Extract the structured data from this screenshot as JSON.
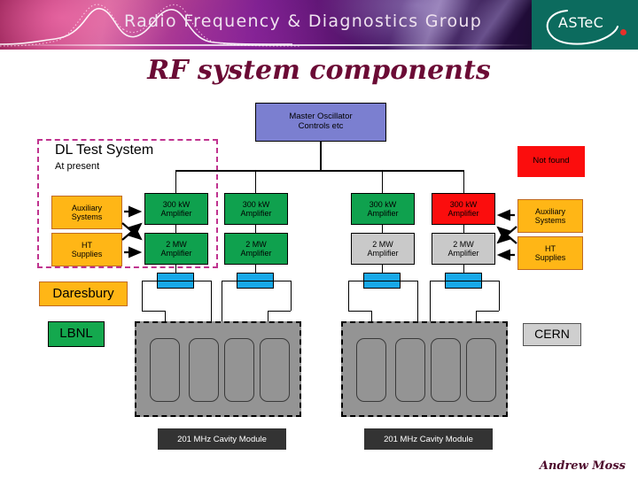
{
  "header": {
    "banner_title": "Radio Frequency & Diagnostics Group",
    "logo_text": "ASTeC",
    "logo_bg": "#0c6b5e",
    "accent": "#6b0b35"
  },
  "slide": {
    "title": "RF system components",
    "author": "Andrew Moss"
  },
  "diagram": {
    "master_oscillator": {
      "line1": "Master Oscillator",
      "line2": "Controls etc",
      "color": "#7b7fd0"
    },
    "dl_test_system": {
      "heading": "DL Test System",
      "subheading": "At present",
      "border_color": "#c0338f"
    },
    "not_found": {
      "label": "Not found",
      "color": "#fb0d0d"
    },
    "left_support": [
      {
        "line1": "Auxiliary",
        "line2": "Systems",
        "color": "#ffb616"
      },
      {
        "line1": "HT",
        "line2": "Supplies",
        "color": "#ffb616"
      }
    ],
    "right_support": [
      {
        "line1": "Auxiliary",
        "line2": "Systems",
        "color": "#ffb616"
      },
      {
        "line1": "HT",
        "line2": "Supplies",
        "color": "#ffb616"
      }
    ],
    "chains": [
      {
        "driver": {
          "line1": "300 kW",
          "line2": "Amplifier",
          "color": "#0fa14e"
        },
        "final": {
          "line1": "2 MW",
          "line2": "Amplifier",
          "color": "#0fa14e"
        },
        "splitter_color": "#18a8e8"
      },
      {
        "driver": {
          "line1": "300 kW",
          "line2": "Amplifier",
          "color": "#0fa14e"
        },
        "final": {
          "line1": "2 MW",
          "line2": "Amplifier",
          "color": "#0fa14e"
        },
        "splitter_color": "#18a8e8"
      },
      {
        "driver": {
          "line1": "300 kW",
          "line2": "Amplifier",
          "color": "#0fa14e"
        },
        "final": {
          "line1": "2 MW",
          "line2": "Amplifier",
          "color": "#c9c9c9"
        },
        "splitter_color": "#18a8e8"
      },
      {
        "driver": {
          "line1": "300 kW",
          "line2": "Amplifier",
          "color": "#fb0d0d"
        },
        "final": {
          "line1": "2 MW",
          "line2": "Amplifier",
          "color": "#c9c9c9"
        },
        "splitter_color": "#18a8e8"
      }
    ],
    "cavity_modules": [
      {
        "label": "201 MHz Cavity Module",
        "cavities": 4
      },
      {
        "label": "201 MHz Cavity Module",
        "cavities": 4
      }
    ],
    "legend": [
      {
        "label": "Daresbury",
        "color": "#ffb616"
      },
      {
        "label": "LBNL",
        "color": "#14a84e"
      },
      {
        "label": "CERN",
        "color": "#cfcfcf"
      }
    ]
  }
}
